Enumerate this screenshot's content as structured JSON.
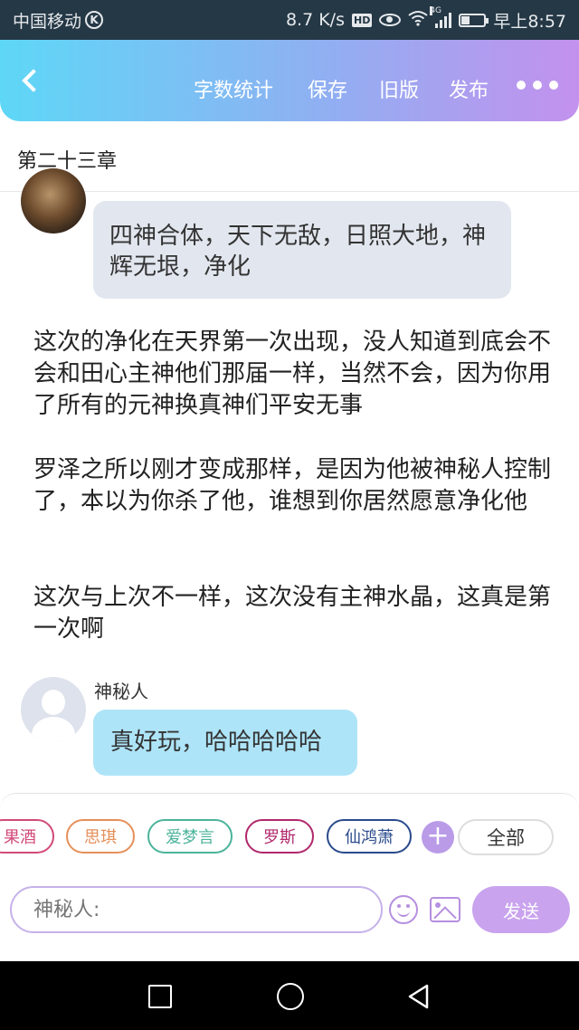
{
  "status_bar": {
    "carrier": "中国移动",
    "carrier_badge": "K",
    "speed": "8.7 K/s",
    "hd": "HD",
    "network": "4G",
    "time": "早上8:57"
  },
  "header": {
    "nav": [
      "字数统计",
      "保存",
      "旧版",
      "发布"
    ],
    "back_icon": "chevron-left-icon",
    "more_icon": "more-dots-icon"
  },
  "chapter_title": "第二十三章",
  "messages": {
    "bubble1": "四神合体，天下无敌，日照大地，神辉无垠，净化",
    "paragraphs": [
      "这次的净化在天界第一次出现，没人知道到底会不会和田心主神他们那届一样，当然不会，因为你用了所有的元神换真神们平安无事",
      "罗泽之所以刚才变成那样，是因为他被神秘人控制了，本以为你杀了他，谁想到你居然愿意净化他",
      "这次与上次不一样，这次没有主神水晶，这真是第一次啊"
    ],
    "speaker2": "神秘人",
    "bubble2": "真好玩，哈哈哈哈哈"
  },
  "roles": [
    {
      "label": "果酒",
      "color": "#d14a7a"
    },
    {
      "label": "思琪",
      "color": "#e6905a"
    },
    {
      "label": "爱梦言",
      "color": "#4bb39a"
    },
    {
      "label": "罗斯",
      "color": "#b0286c"
    },
    {
      "label": "仙鸿萧",
      "color": "#2a4a8c"
    }
  ],
  "all_label": "全部",
  "add_label": "+",
  "input": {
    "placeholder": "神秘人:"
  },
  "send_label": "发送",
  "colors": {
    "header_gradient": [
      "#5ed7f6",
      "#8fb0f2",
      "#c391ee"
    ],
    "accent": "#c9a3ee"
  }
}
